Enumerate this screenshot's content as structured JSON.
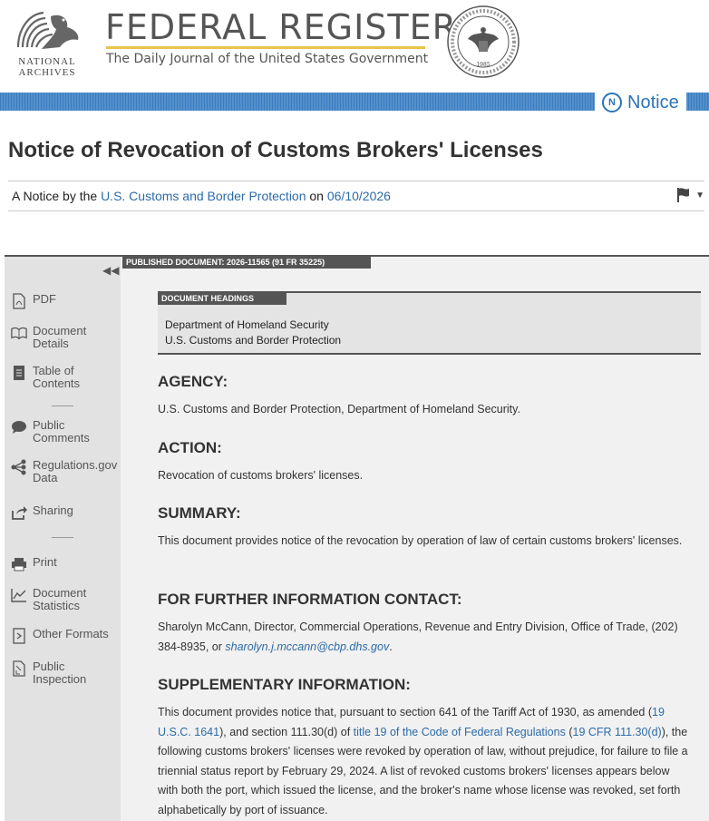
{
  "header": {
    "na_text": "NATIONAL ARCHIVES",
    "title": "FEDERAL REGISTER",
    "tagline": "The Daily Journal of the United States Government",
    "badge_letter": "N",
    "badge_label": "Notice"
  },
  "document": {
    "title": "Notice of Revocation of Customs Brokers' Licenses",
    "byline_prefix": "A Notice by the",
    "agency_link": "U.S. Customs and Border Protection",
    "byline_on": "on",
    "date": "06/10/2026",
    "published_label": "PUBLISHED DOCUMENT: 2026-11565 (91 FR 35225)"
  },
  "sidebar": {
    "items": [
      {
        "label": "PDF",
        "icon": "pdf-icon"
      },
      {
        "label": "Document Details",
        "icon": "book-icon"
      },
      {
        "label": "Table of Contents",
        "icon": "toc-icon"
      },
      {
        "label": "Public Comments",
        "icon": "comment-icon"
      },
      {
        "label": "Regulations.gov Data",
        "icon": "share-nodes-icon"
      },
      {
        "label": "Sharing",
        "icon": "share-icon"
      },
      {
        "label": "Print",
        "icon": "print-icon"
      },
      {
        "label": "Document Statistics",
        "icon": "chart-icon"
      },
      {
        "label": "Other Formats",
        "icon": "code-icon"
      },
      {
        "label": "Public Inspection",
        "icon": "inspection-icon"
      }
    ]
  },
  "headings": {
    "tag": "DOCUMENT HEADINGS",
    "line1": "Department of Homeland Security",
    "line2": "U.S. Customs and Border Protection"
  },
  "sections": {
    "agency_h": "AGENCY:",
    "agency_p": "U.S. Customs and Border Protection, Department of Homeland Security.",
    "action_h": "ACTION:",
    "action_p": "Revocation of customs brokers' licenses.",
    "summary_h": "SUMMARY:",
    "summary_p": "This document provides notice of the revocation by operation of law of certain customs brokers' licenses.",
    "contact_h": "FOR FURTHER INFORMATION CONTACT:",
    "contact_p": "Sharolyn McCann, Director, Commercial Operations, Revenue and Entry Division, Office of Trade, (202) 384-8935, or",
    "contact_email": "sharolyn.j.mccann@cbp.dhs.gov",
    "supp_h": "SUPPLEMENTARY INFORMATION:",
    "supp_p1": "This document provides notice that, pursuant to section 641 of the Tariff Act of 1930, as amended (",
    "supp_link1": "19 U.S.C. 1641",
    "supp_p2": "), and section 111.30(d) of",
    "supp_link2": "title 19 of the Code of Federal Regulations",
    "supp_p3": "(",
    "supp_link3": "19 CFR 111.30(d)",
    "supp_p4": "), the following customs brokers' licenses were revoked by operation of law, without prejudice, for failure to file a triennial status report by February 29, 2024. A list of revoked customs brokers' licenses appears below with both the port, which issued the license, and the broker's name whose license was revoked, set forth alphabetically by port of issuance."
  }
}
